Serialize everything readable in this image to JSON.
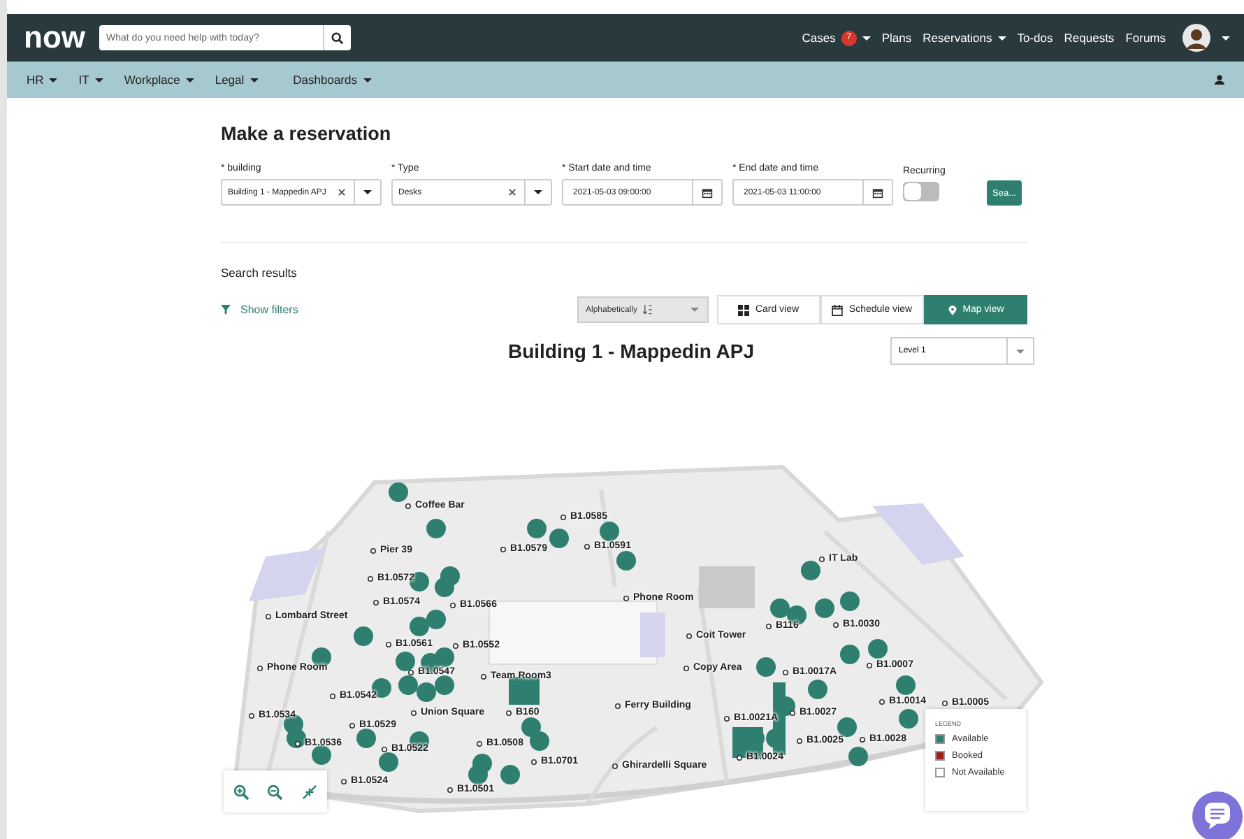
{
  "topbar": {
    "logo": "now",
    "search": {
      "placeholder": "What do you need help with today?"
    },
    "menu": [
      {
        "label": "Cases",
        "badge": "7",
        "caret": true
      },
      {
        "label": "Plans",
        "caret": false
      },
      {
        "label": "Reservations",
        "caret": true
      },
      {
        "label": "To-dos",
        "caret": false
      },
      {
        "label": "Requests",
        "caret": false
      },
      {
        "label": "Forums",
        "caret": false
      }
    ]
  },
  "subnav": [
    {
      "label": "HR"
    },
    {
      "label": "IT"
    },
    {
      "label": "Workplace"
    },
    {
      "label": "Legal"
    },
    {
      "label": "Dashboards"
    }
  ],
  "page_title": "Make a reservation",
  "fields": [
    {
      "kind": "select",
      "label": "* building",
      "value": "Building 1 - Mappedin APJ"
    },
    {
      "kind": "select",
      "label": "* Type",
      "value": "Desks"
    },
    {
      "kind": "datetime",
      "label": "* Start date and time",
      "value": "2021-05-03 09:00:00"
    },
    {
      "kind": "datetime",
      "label": "* End date and time",
      "value": "2021-05-03 11:00:00"
    },
    {
      "kind": "toggle",
      "label": "Recurring",
      "on": false
    }
  ],
  "search_button": "Sea...",
  "results_title": "Search results",
  "show_filters": "Show filters",
  "sort": {
    "value": "Alphabetically"
  },
  "views": [
    {
      "label": "Card view",
      "kind": "card",
      "selected": false
    },
    {
      "label": "Schedule view",
      "kind": "schedule",
      "selected": false
    },
    {
      "label": "Map view",
      "kind": "map",
      "selected": true
    }
  ],
  "building_title": "Building 1 - Mappedin APJ",
  "level": {
    "value": "Level 1"
  },
  "map_labels": [
    "Coffee Bar",
    "B1.0585",
    "Pier 39",
    "B1.0579",
    "B1.0591",
    "IT Lab",
    "B1.0572",
    "B1.0574",
    "B1.0566",
    "Phone Room",
    "Lombard Street",
    "B116",
    "B1.0030",
    "B1.0561",
    "B1.0552",
    "Coit Tower",
    "Phone Room",
    "B1.0547",
    "Team Room3",
    "Copy Area",
    "B1.0017A",
    "B1.0007",
    "B1.0542",
    "B1.0014",
    "B1.0005",
    "B1.0534",
    "Union Square",
    "B160",
    "Ferry Building",
    "B1.0021A",
    "B1.0027",
    "B1.0529",
    "B1.0536",
    "B1.0522",
    "B1.0508",
    "B1.0701",
    "B1.0025",
    "B1.0028",
    "B1.0024",
    "Ghirardelli Square",
    "B1.0524",
    "B1.0501"
  ],
  "legend": {
    "title": "LEGEND",
    "items": [
      {
        "label": "Available",
        "color": "#2f7f70"
      },
      {
        "label": "Booked",
        "color": "#a31a1a"
      },
      {
        "label": "Not Available",
        "color": "#ffffff"
      }
    ]
  }
}
